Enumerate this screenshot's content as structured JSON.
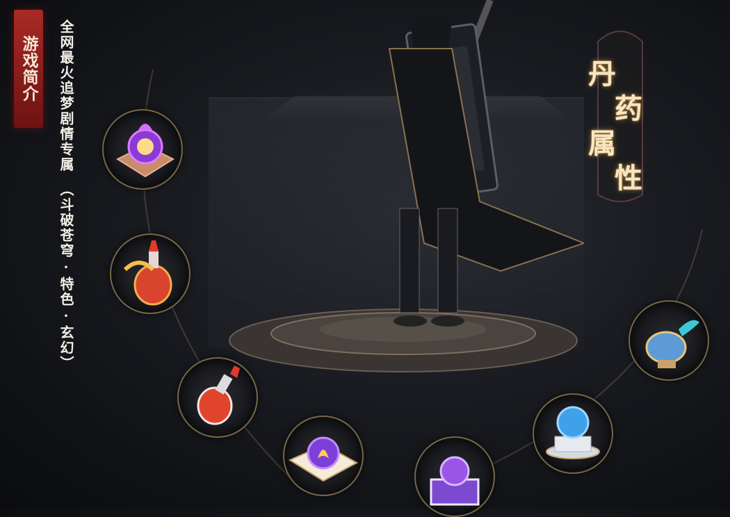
{
  "intro": {
    "tag": "游戏简介",
    "line1": "全网最火追梦剧情专属",
    "line2": "（斗破苍穹·特色·玄幻）"
  },
  "attribute_title": {
    "chars": [
      "丹",
      "药",
      "属",
      "性"
    ]
  },
  "potions": [
    {
      "name": "purple-orb-on-cloth-icon"
    },
    {
      "name": "red-gold-gourd-icon"
    },
    {
      "name": "red-silver-gourd-icon"
    },
    {
      "name": "purple-flame-scroll-icon"
    },
    {
      "name": "purple-crystal-box-icon"
    },
    {
      "name": "blue-orb-pedestal-icon"
    },
    {
      "name": "blue-lamp-vessel-icon"
    }
  ],
  "colors": {
    "accent_red": "#a82a26",
    "gold": "#c9a36a",
    "title_glow": "#e6b45a"
  }
}
